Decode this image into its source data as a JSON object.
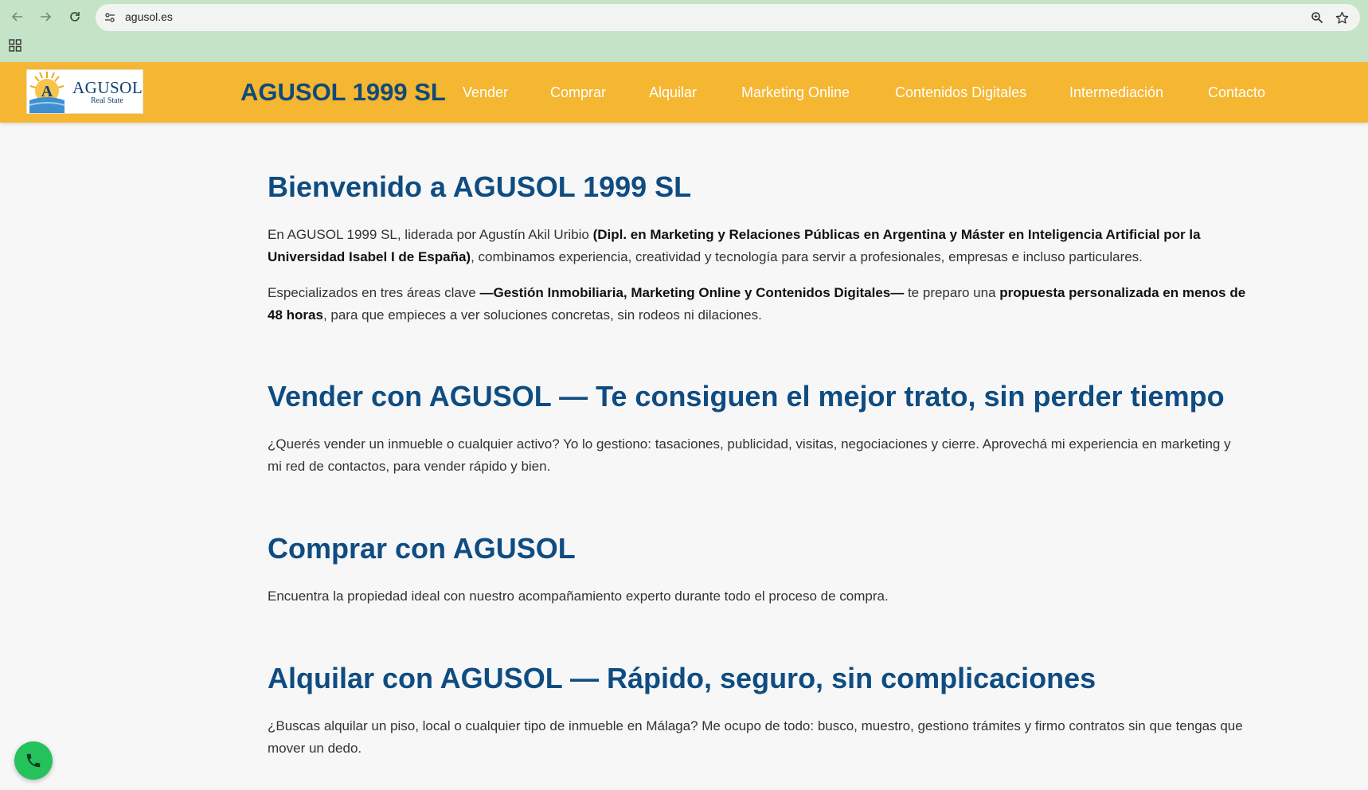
{
  "browser": {
    "url": "agusol.es",
    "icons": [
      "back-arrow-icon",
      "forward-arrow-icon",
      "reload-icon",
      "site-info-icon",
      "zoom-icon",
      "bookmark-star-icon",
      "apps-grid-icon"
    ]
  },
  "header": {
    "logo_text": "AGUSOL",
    "logo_subtext": "Real State",
    "brand": "AGUSOL 1999 SL",
    "menu": [
      "Vender",
      "Comprar",
      "Alquilar",
      "Marketing Online",
      "Contenidos Digitales",
      "Intermediación",
      "Contacto"
    ],
    "colors": {
      "header_bg": "#f5b631",
      "brand": "#104a78",
      "heading": "#0f4c81"
    }
  },
  "sections": {
    "welcome": {
      "title": "Bienvenido a AGUSOL 1999 SL",
      "p1_a": "En AGUSOL 1999 SL, liderada por Agustín Akil Uribio ",
      "p1_b": "(Dipl. en Marketing y Relaciones Públicas en Argentina y Máster en Inteligencia Artificial por la Universidad Isabel I de España)",
      "p1_c": ", combinamos experiencia, creatividad y tecnología para servir a profesionales, empresas e incluso particulares.",
      "p2_a": "Especializados en tres áreas clave ",
      "p2_b": "—Gestión Inmobiliaria, Marketing Online y Contenidos Digitales—",
      "p2_c": " te preparo una ",
      "p2_d": "propuesta personalizada en menos de 48 horas",
      "p2_e": ", para que empieces a ver soluciones concretas, sin rodeos ni dilaciones."
    },
    "vender": {
      "title": "Vender con AGUSOL — Te consiguen el mejor trato, sin perder tiempo",
      "text": "¿Querés vender un inmueble o cualquier activo? Yo lo gestiono: tasaciones, publicidad, visitas, negociaciones y cierre. Aprovechá mi experiencia en marketing y mi red de contactos, para vender rápido y bien."
    },
    "comprar": {
      "title": "Comprar con AGUSOL",
      "text": "Encuentra la propiedad ideal con nuestro acompañamiento experto durante todo el proceso de compra."
    },
    "alquilar": {
      "title": "Alquilar con AGUSOL — Rápido, seguro, sin complicaciones",
      "text": "¿Buscas alquilar un piso, local o cualquier tipo de inmueble en Málaga? Me ocupo de todo: busco, muestro, gestiono trámites y firmo contratos sin que tengas que mover un dedo."
    }
  },
  "fab": {
    "icon": "phone-icon",
    "color": "#25c25c"
  }
}
